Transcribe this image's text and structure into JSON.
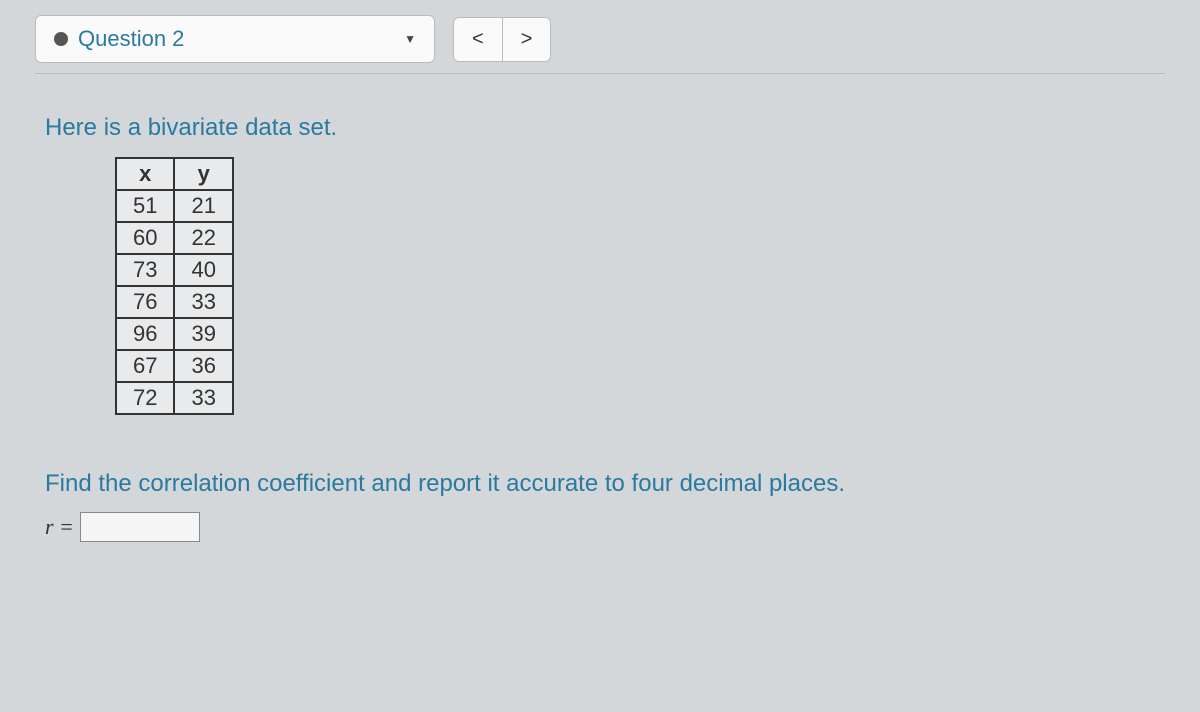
{
  "header": {
    "question_label": "Question 2",
    "prev": "<",
    "next": ">"
  },
  "intro": "Here is a bivariate data set.",
  "table": {
    "headers": [
      "x",
      "y"
    ],
    "rows": [
      [
        "51",
        "21"
      ],
      [
        "60",
        "22"
      ],
      [
        "73",
        "40"
      ],
      [
        "76",
        "33"
      ],
      [
        "96",
        "39"
      ],
      [
        "67",
        "36"
      ],
      [
        "72",
        "33"
      ]
    ]
  },
  "instruction": "Find the correlation coefficient and report it accurate to four decimal places.",
  "answer": {
    "label": "r =",
    "value": ""
  }
}
